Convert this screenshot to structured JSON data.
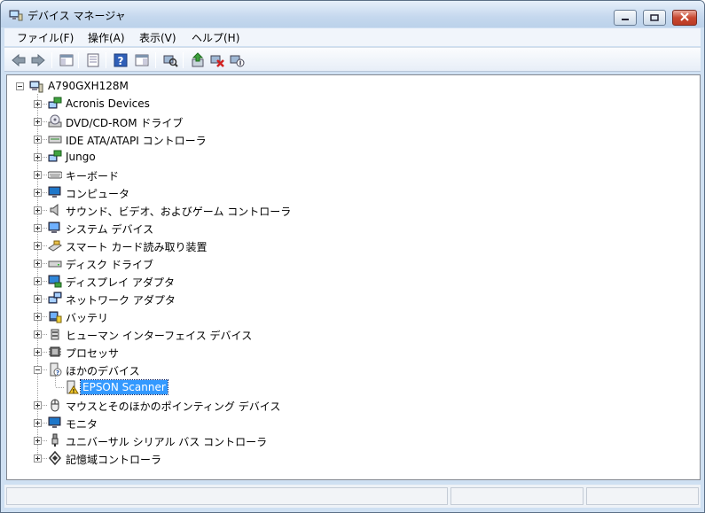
{
  "window": {
    "title": "デバイス マネージャ",
    "controls": {
      "minimize": "minimize",
      "maximize": "maximize",
      "close": "close"
    }
  },
  "menu": [
    {
      "label": "ファイル(F)"
    },
    {
      "label": "操作(A)"
    },
    {
      "label": "表示(V)"
    },
    {
      "label": "ヘルプ(H)"
    }
  ],
  "toolbar": [
    {
      "icon": "back-arrow-icon"
    },
    {
      "icon": "forward-arrow-icon"
    },
    {
      "icon": "show-hide-console-tree-icon"
    },
    {
      "icon": "properties-icon"
    },
    {
      "icon": "help-icon"
    },
    {
      "icon": "show-hide-action-pane-icon"
    },
    {
      "icon": "scan-hardware-changes-icon"
    },
    {
      "icon": "update-driver-icon"
    },
    {
      "icon": "uninstall-icon"
    },
    {
      "icon": "disable-device-icon"
    }
  ],
  "tree": {
    "root": {
      "label": "A790GXH128M",
      "icon": "computer-icon"
    },
    "categories": [
      {
        "label": "Acronis Devices",
        "icon": "network-device-icon",
        "expanded": false
      },
      {
        "label": "DVD/CD-ROM ドライブ",
        "icon": "optical-drive-icon",
        "expanded": false
      },
      {
        "label": "IDE ATA/ATAPI コントローラ",
        "icon": "ide-controller-icon",
        "expanded": false
      },
      {
        "label": "Jungo",
        "icon": "network-device-icon",
        "expanded": false
      },
      {
        "label": "キーボード",
        "icon": "keyboard-icon",
        "expanded": false
      },
      {
        "label": "コンピュータ",
        "icon": "monitor-icon",
        "expanded": false
      },
      {
        "label": "サウンド、ビデオ、およびゲーム コントローラ",
        "icon": "speaker-icon",
        "expanded": false
      },
      {
        "label": "システム デバイス",
        "icon": "system-device-icon",
        "expanded": false
      },
      {
        "label": "スマート カード読み取り装置",
        "icon": "smart-card-reader-icon",
        "expanded": false
      },
      {
        "label": "ディスク ドライブ",
        "icon": "disk-drive-icon",
        "expanded": false
      },
      {
        "label": "ディスプレイ アダプタ",
        "icon": "display-adapter-icon",
        "expanded": false
      },
      {
        "label": "ネットワーク アダプタ",
        "icon": "network-adapter-icon",
        "expanded": false
      },
      {
        "label": "バッテリ",
        "icon": "battery-icon",
        "expanded": false
      },
      {
        "label": "ヒューマン インターフェイス デバイス",
        "icon": "hid-icon",
        "expanded": false
      },
      {
        "label": "プロセッサ",
        "icon": "processor-icon",
        "expanded": false
      },
      {
        "label": "ほかのデバイス",
        "icon": "unknown-device-icon",
        "expanded": true,
        "children": [
          {
            "label": "EPSON Scanner",
            "icon": "warning-device-icon",
            "selected": true
          }
        ]
      },
      {
        "label": "マウスとそのほかのポインティング デバイス",
        "icon": "mouse-icon",
        "expanded": false
      },
      {
        "label": "モニタ",
        "icon": "monitor-icon",
        "expanded": false
      },
      {
        "label": "ユニバーサル シリアル バス コントローラ",
        "icon": "usb-icon",
        "expanded": false
      },
      {
        "label": "記憶域コントローラ",
        "icon": "storage-controller-icon",
        "expanded": false
      }
    ]
  }
}
